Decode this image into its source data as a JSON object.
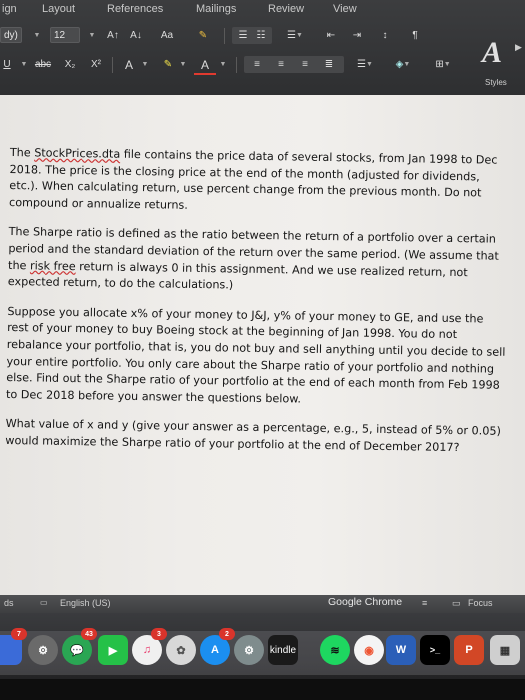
{
  "ribbon": {
    "tabs": [
      "ign",
      "Layout",
      "References",
      "Mailings",
      "Review",
      "View"
    ],
    "style_box": "dy)",
    "font_size": "12",
    "grow_font": "A↑",
    "shrink_font": "A↓",
    "aa_label": "Aa",
    "underline": "U",
    "strike": "abc",
    "subscript": "X₂",
    "superscript": "X²",
    "text_effects": "A",
    "font_color": "A",
    "styles_label": "Styles"
  },
  "document": {
    "paragraphs": [
      {
        "before": "The ",
        "link": "StockPrices.dta",
        "after": " file contains the price data of several stocks, from Jan 1998 to Dec 2018. The price is the closing price at the end of the month (adjusted for dividends, etc.). When calculating return, use percent change from the previous month. Do not compound or annualize returns."
      },
      {
        "before": "The Sharpe ratio is defined as the ratio between the return of a portfolio over a certain period and the standard deviation of the return over the same period. (We assume that the ",
        "link": "risk free",
        "after": " return is always 0 in this assignment. And we use realized return, not expected return, to do the calculations.)"
      },
      {
        "before": "Suppose you allocate x% of your money to J&J, y% of your money to GE, and use the rest of your money to buy Boeing stock at the beginning of Jan 1998. You do not rebalance your portfolio, that is, you do not buy and sell anything until you decide to sell your entire portfolio. You only care about the Sharpe ratio of your portfolio and nothing else. Find out the Sharpe ratio of your portfolio at the end of each month from Feb 1998 to Dec 2018 before you answer the questions below.",
        "link": "",
        "after": ""
      },
      {
        "before": "What value of x and y (give your answer as a percentage, e.g., 5, instead of 5% or 0.05) would maximize the Sharpe ratio of your portfolio at the end of December 2017?",
        "link": "",
        "after": ""
      }
    ]
  },
  "statusbar": {
    "left": "ds",
    "language": "English (US)",
    "app": "Google Chrome",
    "focus": "Focus"
  },
  "dock": {
    "badges": [
      "7",
      "43",
      "3",
      "2"
    ],
    "kindle_label": "kindle",
    "word_label": "W",
    "terminal_label": ">_",
    "ppt_label": "P"
  },
  "colors": {
    "ribbon_bg": "#343537",
    "page_bg": "#efedea",
    "text": "#151515",
    "spell_underline": "#cc3333",
    "badge": "#d9342b"
  }
}
